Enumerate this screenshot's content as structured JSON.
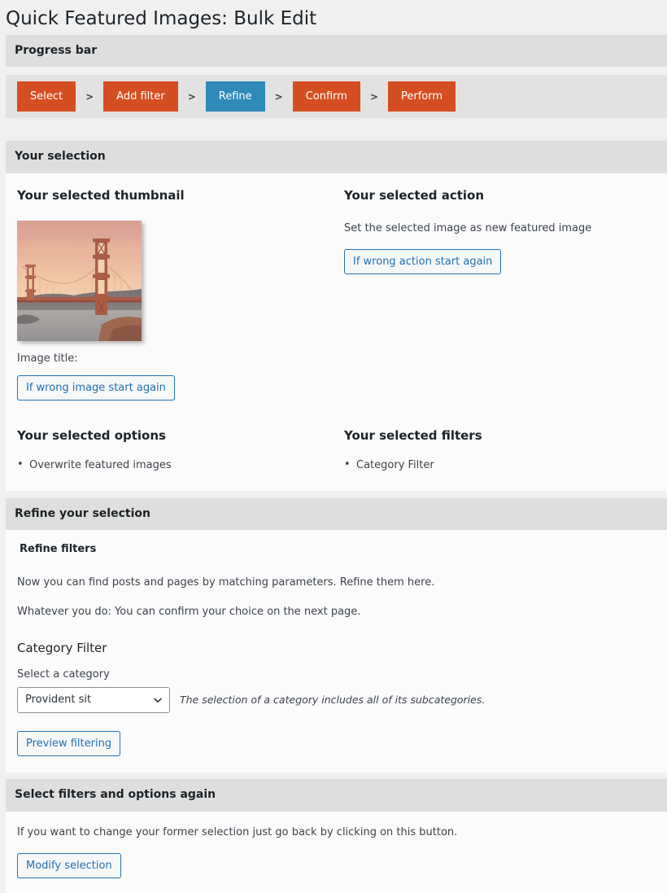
{
  "page": {
    "title": "Quick Featured Images: Bulk Edit"
  },
  "progress": {
    "header": "Progress bar",
    "separator": ">",
    "steps": [
      {
        "label": "Select",
        "state": "done"
      },
      {
        "label": "Add filter",
        "state": "done"
      },
      {
        "label": "Refine",
        "state": "current"
      },
      {
        "label": "Confirm",
        "state": "done"
      },
      {
        "label": "Perform",
        "state": "done"
      }
    ],
    "colors": {
      "step": "#d54e21",
      "current": "#2e8ab8",
      "strip_bg": "#e2e2e2"
    }
  },
  "selection": {
    "header": "Your selection",
    "thumbnail_title": "Your selected thumbnail",
    "image_title_label": "Image title:",
    "image_title_value": "",
    "wrong_image_button": "If wrong image start again",
    "action_title": "Your selected action",
    "action_description": "Set the selected image as new featured image",
    "wrong_action_button": "If wrong action start again",
    "options_title": "Your selected options",
    "options": [
      "Overwrite featured images"
    ],
    "filters_title": "Your selected filters",
    "filters": [
      "Category Filter"
    ]
  },
  "refine": {
    "header": "Refine your selection",
    "subheading": "Refine filters",
    "paragraph_1": "Now you can find posts and pages by matching parameters. Refine them here.",
    "paragraph_2": "Whatever you do: You can confirm your choice on the next page.",
    "filter_title": "Category Filter",
    "select_label": "Select a category",
    "select_value": "Provident sit",
    "select_options": [
      "Provident sit"
    ],
    "select_note": "The selection of a category includes all of its subcategories.",
    "preview_button": "Preview filtering"
  },
  "again": {
    "header": "Select filters and options again",
    "description": "If you want to change your former selection just go back by clicking on this button.",
    "modify_button": "Modify selection"
  },
  "theme": {
    "accent_blue": "#2271b1",
    "panel_header_bg": "#dedede",
    "page_bg": "#f0f0f1"
  }
}
